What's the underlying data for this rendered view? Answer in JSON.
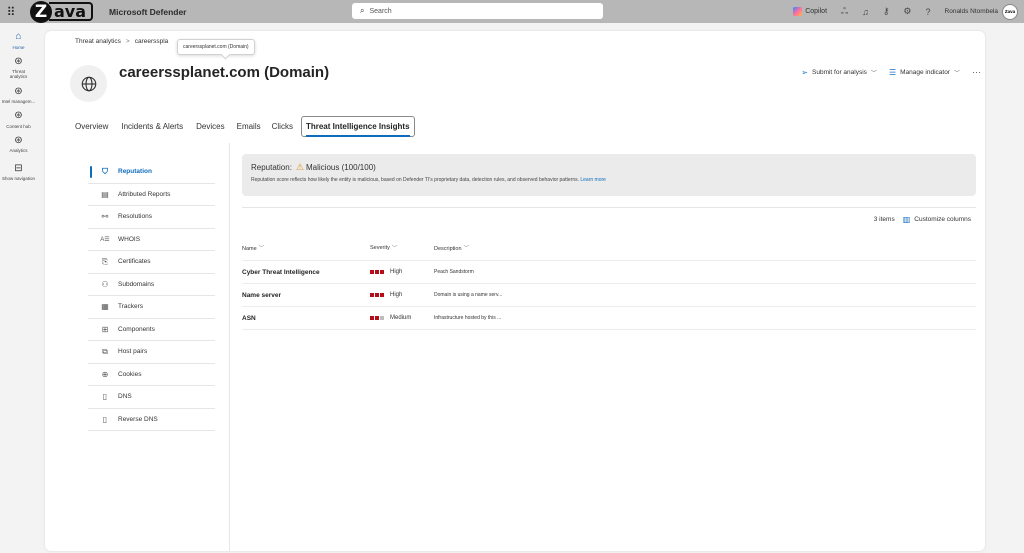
{
  "topbar": {
    "logo_first": "Z",
    "logo_rest": "ava",
    "product": "Microsoft Defender",
    "search_placeholder": "Search",
    "copilot": "Copilot",
    "username": "Ronalds Ntombela",
    "avatar_text": "Zava"
  },
  "rail": {
    "items": [
      {
        "label": "Home"
      },
      {
        "label": "Threat analytics"
      },
      {
        "label": "Intel managem..."
      },
      {
        "label": "Content hub"
      },
      {
        "label": "Analytics"
      },
      {
        "label": "Show navigation"
      }
    ]
  },
  "breadcrumb": {
    "root": "Threat analytics",
    "sep": ">",
    "current": "careersspla",
    "tooltip": "careerssplanet.com (Domain)"
  },
  "entity": {
    "title": "careerssplanet.com (Domain)"
  },
  "actions": {
    "submit": "Submit for analysis",
    "manage": "Manage indicator",
    "more": "···"
  },
  "tabs": [
    "Overview",
    "Incidents & Alerts",
    "Devices",
    "Emails",
    "Clicks",
    "Threat Intelligence Insights"
  ],
  "subnav": [
    {
      "label": "Reputation"
    },
    {
      "label": "Attributed Reports"
    },
    {
      "label": "Resolutions"
    },
    {
      "label": "WHOIS"
    },
    {
      "label": "Certificates"
    },
    {
      "label": "Subdomains"
    },
    {
      "label": "Trackers"
    },
    {
      "label": "Components"
    },
    {
      "label": "Host pairs"
    },
    {
      "label": "Cookies"
    },
    {
      "label": "DNS"
    },
    {
      "label": "Reverse DNS"
    }
  ],
  "reputation": {
    "label": "Reputation:",
    "verdict": "Malicious (100/100)",
    "description": "Reputation score reflects how likely the entity is malicious, based on Defender TI's proprietary data, detection rules, and observed behavior patterns.",
    "learn_more": "Learn more"
  },
  "list": {
    "count": "3 items",
    "customize": "Customize columns",
    "columns": [
      "Name",
      "Severity",
      "Description"
    ],
    "rows": [
      {
        "name": "Cyber Threat Intelligence",
        "severity": "High",
        "severity_level": 3,
        "description": "Peach Sandstorm"
      },
      {
        "name": "Name server",
        "severity": "High",
        "severity_level": 3,
        "description": "Domain is using a name serv..."
      },
      {
        "name": "ASN",
        "severity": "Medium",
        "severity_level": 2,
        "description": "Infrastructure hosted by this ..."
      }
    ]
  },
  "colors": {
    "accent": "#0f6cbd",
    "severity_high": "#b50e1b",
    "warning": "#e0901a"
  }
}
